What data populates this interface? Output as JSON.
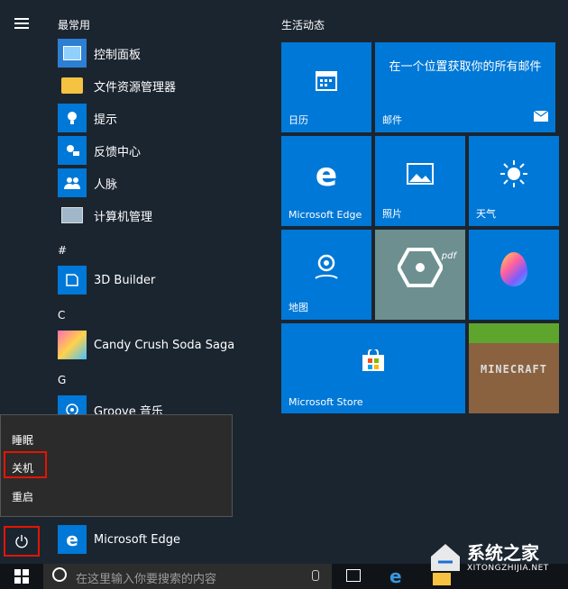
{
  "sections": {
    "most_used": "最常用",
    "hash": "#",
    "c": "C",
    "g": "G",
    "live": "生活动态"
  },
  "most_used": [
    {
      "label": "控制面板",
      "icon": "control-panel-icon"
    },
    {
      "label": "文件资源管理器",
      "icon": "folder-icon"
    },
    {
      "label": "提示",
      "icon": "lightbulb-icon"
    },
    {
      "label": "反馈中心",
      "icon": "feedback-icon"
    },
    {
      "label": "人脉",
      "icon": "people-icon"
    },
    {
      "label": "计算机管理",
      "icon": "computer-management-icon"
    }
  ],
  "apps": {
    "builder": "3D Builder",
    "candy": "Candy Crush Soda Saga",
    "groove": "Groove 音乐",
    "edge": "Microsoft Edge"
  },
  "tiles": {
    "calendar": "日历",
    "mail_text": "在一个位置获取你的所有邮件",
    "mail": "邮件",
    "edge": "Microsoft Edge",
    "photos": "照片",
    "weather": "天气",
    "maps": "地图",
    "store": "Microsoft Store",
    "minecraft": "MINECRAFT",
    "paint_tag": "pdf"
  },
  "power_menu": [
    "睡眠",
    "关机",
    "重启"
  ],
  "search_placeholder": "在这里输入你要搜索的内容",
  "watermark": {
    "brand": "系统之家",
    "url": "XITONGZHIJIA.NET"
  },
  "colors": {
    "tile": "#0078d7",
    "highlight": "#e51400",
    "bg": "#1b2530"
  }
}
